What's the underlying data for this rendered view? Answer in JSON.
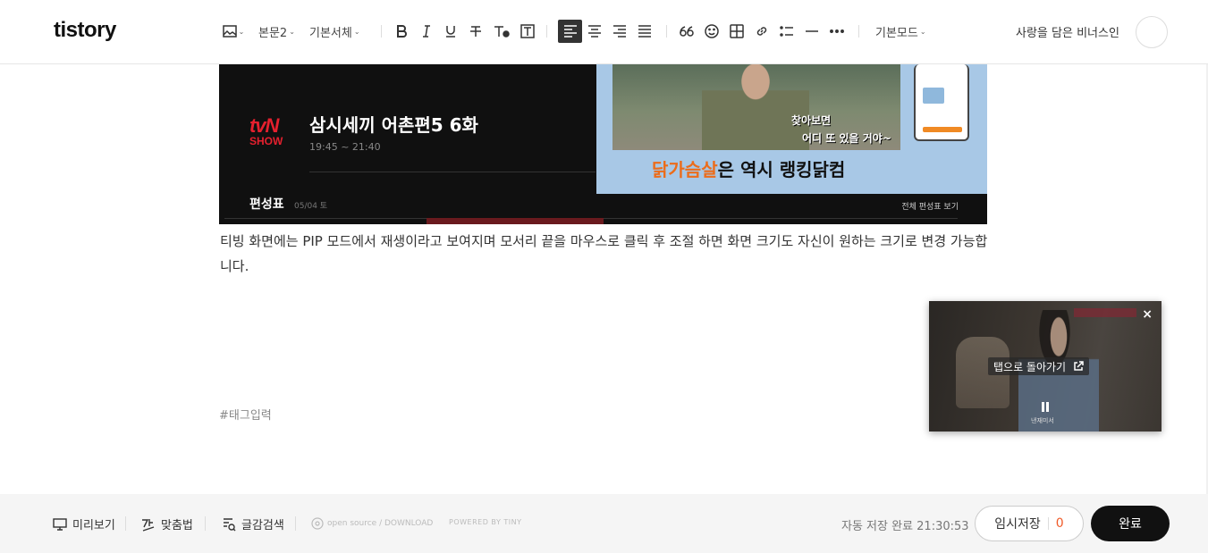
{
  "app": {
    "logo": "tistory"
  },
  "toolbar": {
    "paragraph_style": "본문2",
    "font_family": "기본서체",
    "mode": "기본모드",
    "user_name": "사랑을 담은 비너스인"
  },
  "content": {
    "image": {
      "channel_line1": "tvN",
      "channel_line2": "SHOW",
      "program_title": "삼시세끼 어촌편5 6화",
      "program_time": "19:45 ~ 21:40",
      "schedule_label": "편성표",
      "schedule_date": "05/04 토",
      "schedule_all": "전체 편성표 보기",
      "ad_caption1": "찾아보면",
      "ad_caption2": "어디 또 있을 거야~",
      "ad_slogan_orange": "닭가슴살",
      "ad_slogan_rest": "은 역시 랭킹닭컴"
    },
    "paragraph": "티빙 화면에는 PIP 모드에서 재생이라고 보여지며 모서리 끝을 마우스로 클릭 후 조절 하면 화면 크기도 자신이 원하는 크기로 변경 가능합니다.",
    "tag_placeholder": "#태그입력"
  },
  "pip": {
    "close": "×",
    "back_to_tab": "탭으로 돌아가기",
    "subtitle": "낸재미서"
  },
  "bottom": {
    "preview": "미리보기",
    "spellcheck": "맞춤법",
    "search": "글감검색",
    "opensource": "open source / DOWNLOAD",
    "powered": "POWERED BY TINY",
    "autosave": "자동 저장 완료 21:30:53",
    "draft_label": "임시저장",
    "draft_count": "0",
    "done_label": "완료"
  },
  "colors": {
    "accent": "#f05a28",
    "primary_button": "#111111",
    "active_tool": "#333333"
  }
}
